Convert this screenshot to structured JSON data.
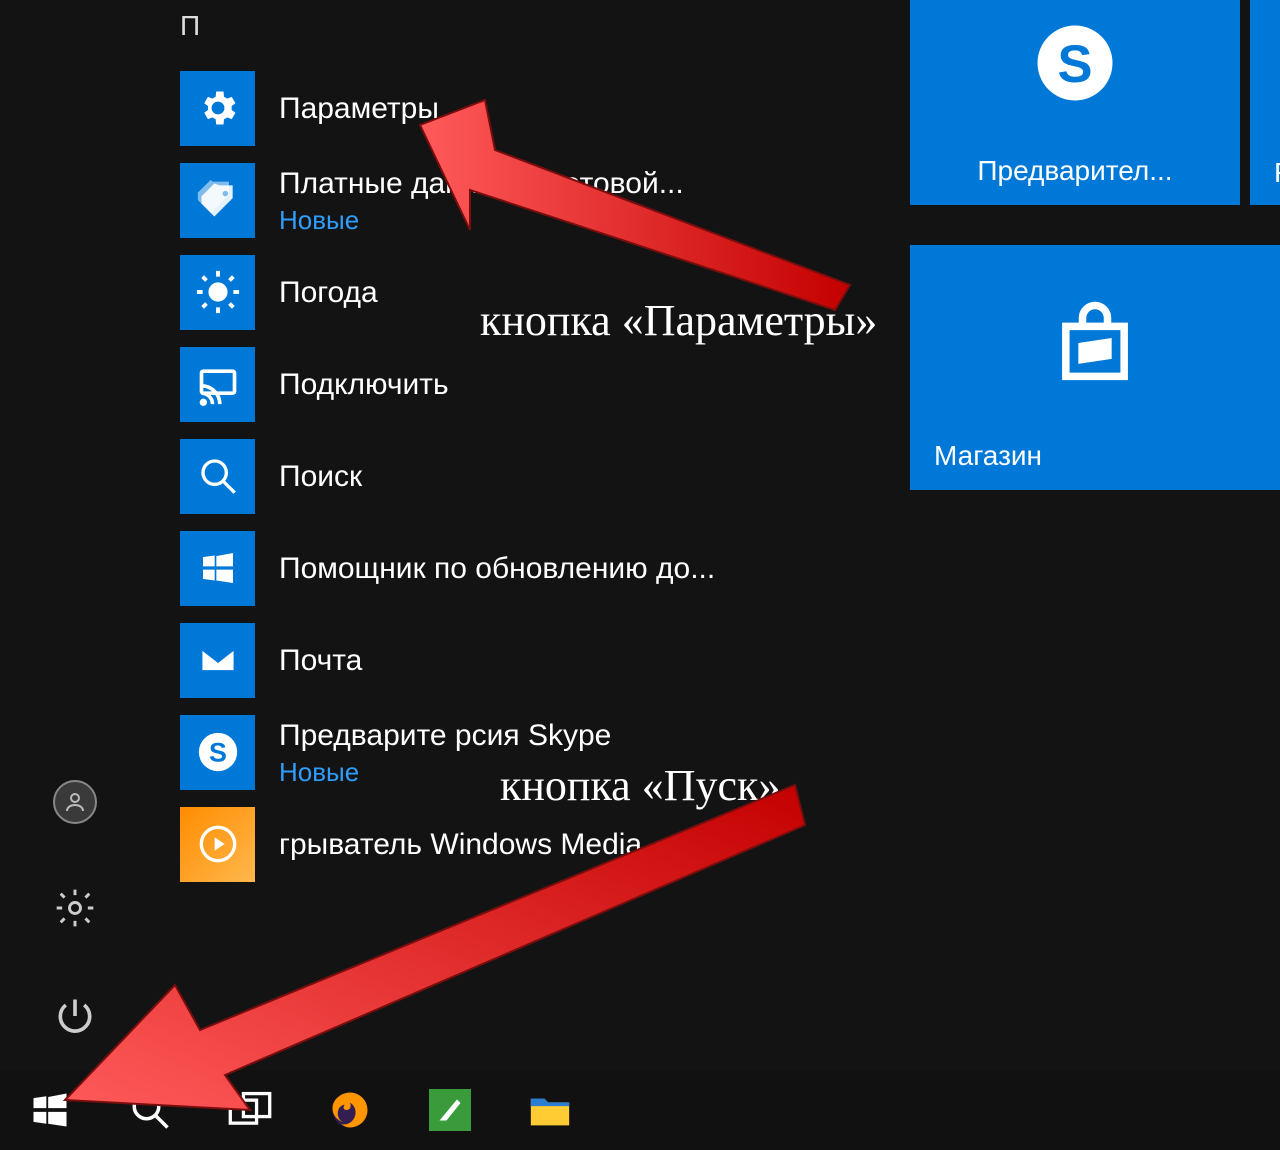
{
  "section_letter": "П",
  "apps": [
    {
      "label": "Параметры",
      "sublabel": null,
      "icon": "gear"
    },
    {
      "label": "Платные данные v         сотовой...",
      "sublabel": "Новые",
      "icon": "tags"
    },
    {
      "label": "Погода",
      "sublabel": null,
      "icon": "sun"
    },
    {
      "label": "Подключить",
      "sublabel": null,
      "icon": "cast"
    },
    {
      "label": "Поиск",
      "sublabel": null,
      "icon": "search"
    },
    {
      "label": "Помощник по обновлению до...",
      "sublabel": null,
      "icon": "windows"
    },
    {
      "label": "Почта",
      "sublabel": null,
      "icon": "mail"
    },
    {
      "label": "Предварите                  рсия Skype",
      "sublabel": "Новые",
      "icon": "skype"
    },
    {
      "label": "            грыватель Windows Media",
      "sublabel": null,
      "icon": "media"
    }
  ],
  "tiles": {
    "skype": "Предварител...",
    "right_fragment": "F",
    "store": "Магазин"
  },
  "annotations": {
    "params": "кнопка «Параметры»",
    "start": "кнопка «Пуск»"
  },
  "colors": {
    "accent": "#0078d7",
    "arrow_fill": "#e81b1b",
    "arrow_stroke": "#8a0e0e"
  }
}
